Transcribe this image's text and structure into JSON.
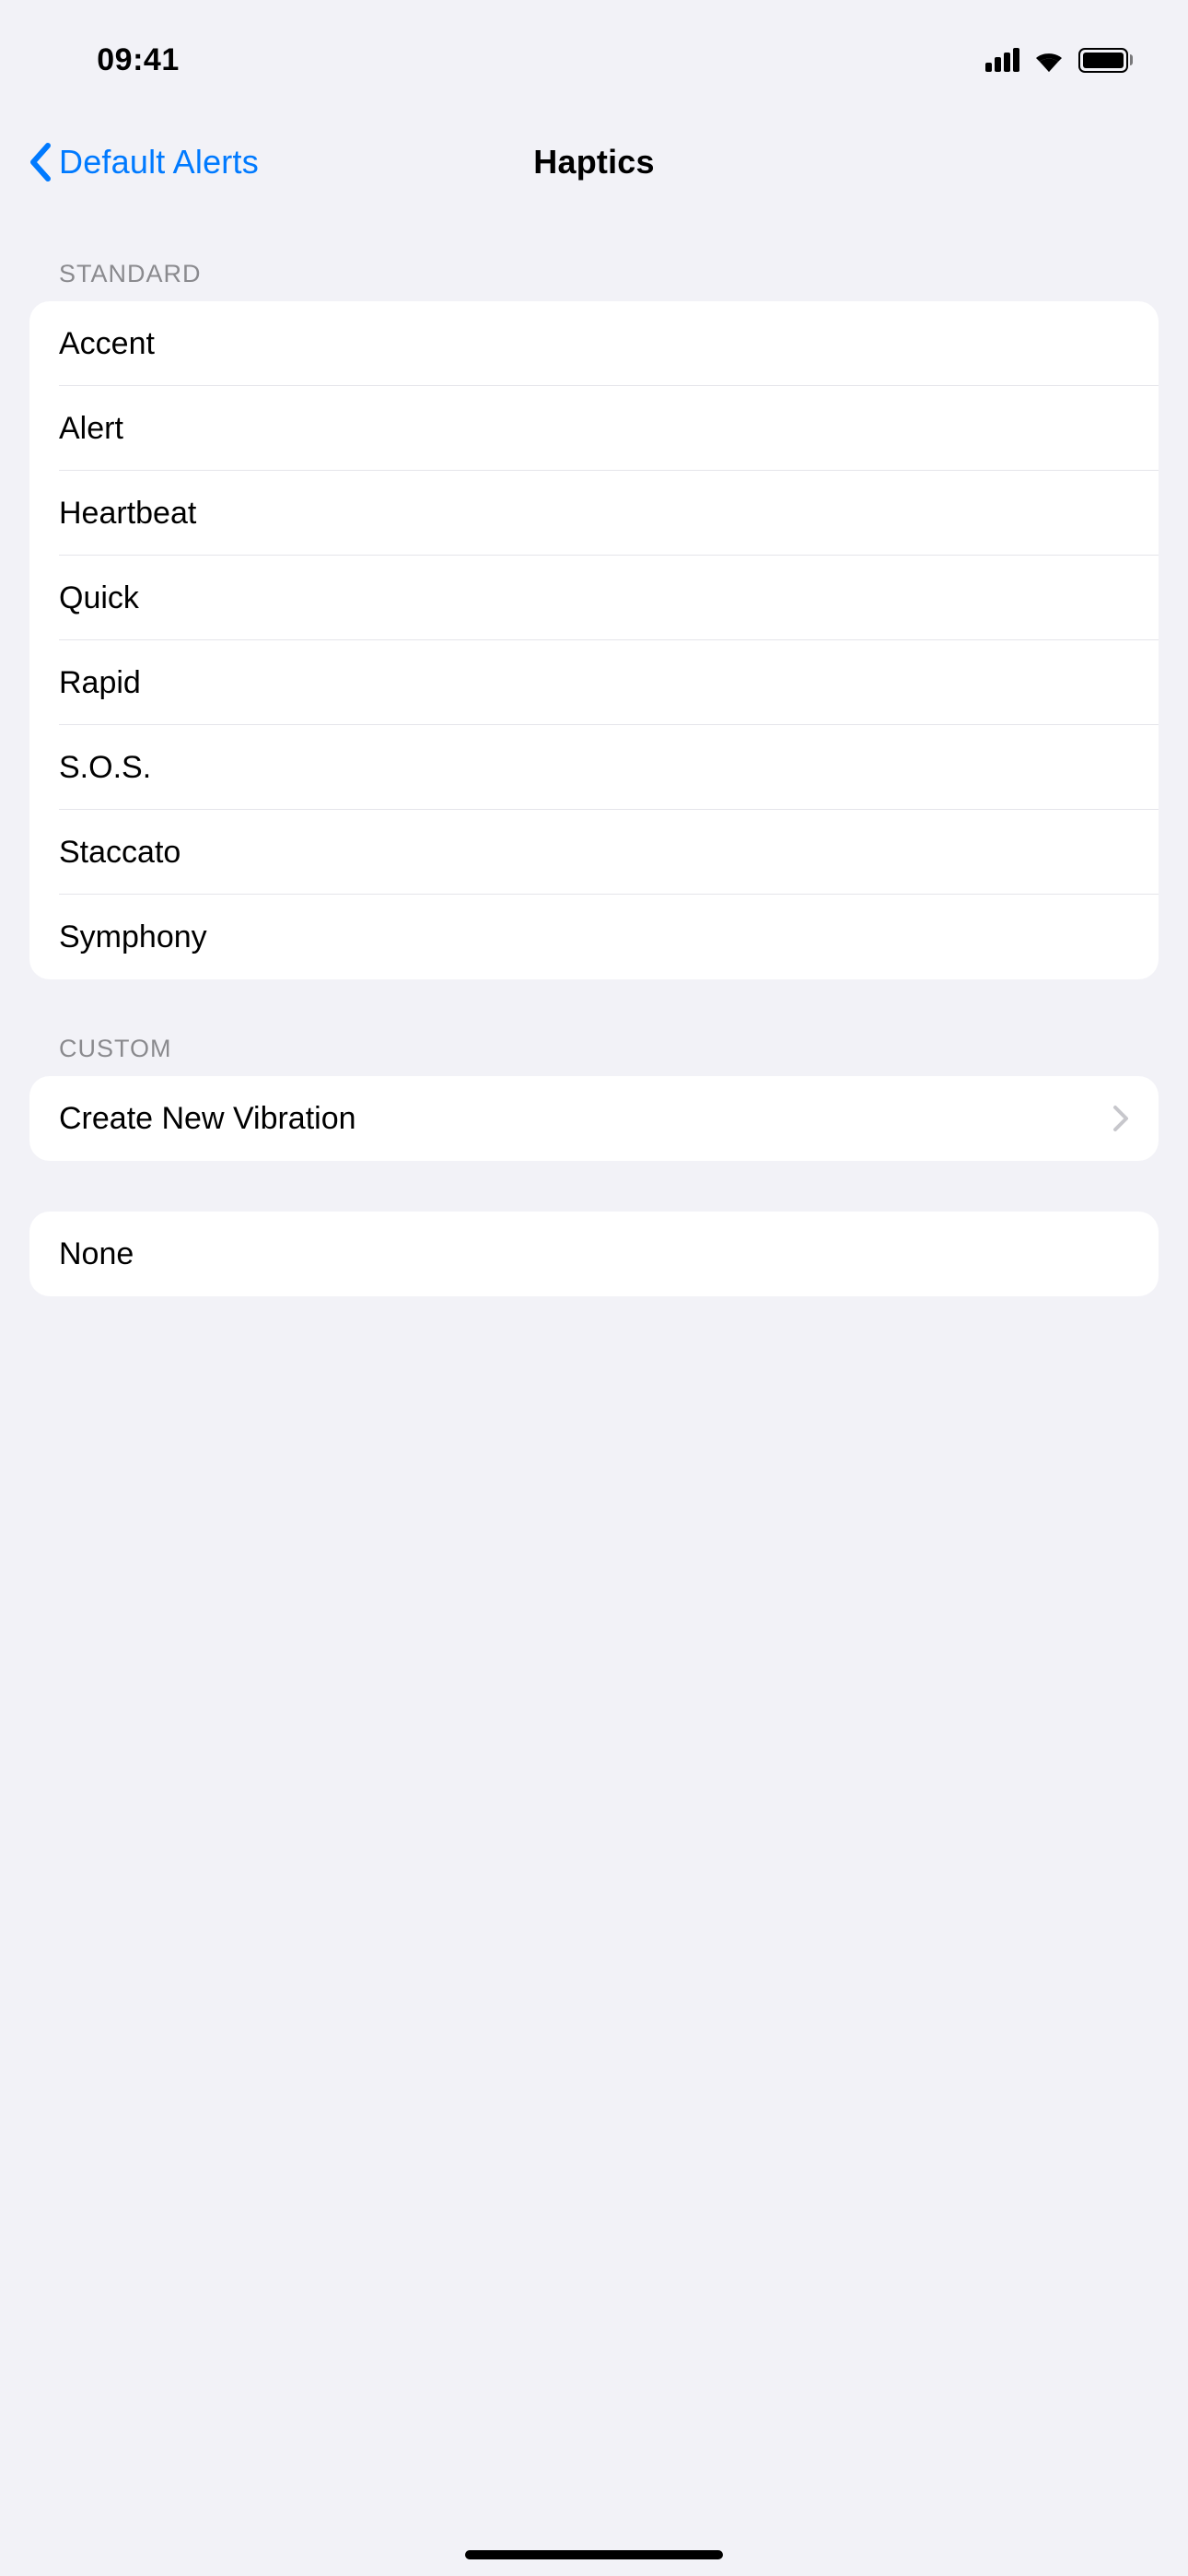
{
  "status": {
    "time": "09:41"
  },
  "nav": {
    "back_label": "Default Alerts",
    "title": "Haptics"
  },
  "sections": {
    "standard": {
      "header": "STANDARD",
      "items": [
        "Accent",
        "Alert",
        "Heartbeat",
        "Quick",
        "Rapid",
        "S.O.S.",
        "Staccato",
        "Symphony"
      ]
    },
    "custom": {
      "header": "CUSTOM",
      "create_label": "Create New Vibration"
    },
    "none": {
      "label": "None"
    }
  }
}
